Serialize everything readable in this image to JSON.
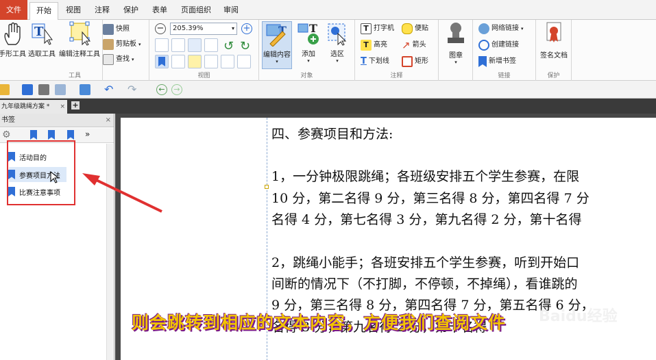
{
  "menu": {
    "tabs": [
      {
        "label": "文件"
      },
      {
        "label": "开始"
      },
      {
        "label": "视图"
      },
      {
        "label": "注释"
      },
      {
        "label": "保护"
      },
      {
        "label": "表单"
      },
      {
        "label": "页面组织"
      },
      {
        "label": "审阅"
      }
    ]
  },
  "ribbon": {
    "tools": {
      "group_label": "工具",
      "hand": "手形工具",
      "select": "选取工具",
      "edit_annot": "编辑注释工具",
      "snapshot": "快照",
      "clipboard": "剪贴板",
      "find": "查找"
    },
    "view": {
      "group_label": "视图",
      "zoom_value": "205.39%"
    },
    "objects": {
      "group_label": "对象",
      "edit_content": "编辑内容",
      "add": "添加",
      "select_area": "选区"
    },
    "comment": {
      "group_label": "注释",
      "typewriter": "打字机",
      "note": "便贴",
      "highlight": "高亮",
      "arrow": "箭头",
      "underline": "下划线",
      "rectangle": "矩形"
    },
    "stamp": {
      "label": "图章"
    },
    "links": {
      "group_label": "链接",
      "web_link": "网络链接",
      "create_link": "创建链接",
      "new_bookmark": "新增书签"
    },
    "protect": {
      "group_label": "保护",
      "sign": "签名文档"
    }
  },
  "document_tab": {
    "title": "九年级跳绳方案 *",
    "close": "×",
    "new_tab": "+"
  },
  "bookmarks_panel": {
    "title": "书签",
    "close": "×",
    "items": [
      {
        "label": "活动目的"
      },
      {
        "label": "参赛项目方法"
      },
      {
        "label": "比赛注意事项"
      }
    ]
  },
  "document": {
    "lines": [
      "四、参赛项目和方法:",
      "1，一分钟极限跳绳；各班级安排五个学生参赛，在限",
      "10 分，第二名得 9 分，第三名得 8 分，第四名得 7 分",
      "名得 4 分，第七名得 3 分，第九名得 2 分，第十名得",
      "2，跳绳小能手；各班安排五个学生参赛，听到开始口",
      "间断的情况下（不打脚，不停顿，不掉绳），看谁跳的",
      "9 分，第三名得 8 分，第四名得 7 分，第五名得 6 分，",
      "名得 3 分，第九名得 2 分，第十名得"
    ]
  },
  "overlay": {
    "subtitle": "则会跳转到相应的文本内容，方便我们查阅文件",
    "watermark_baidu": "Baidu经验",
    "watermark_url": "jingyan.baidu.com"
  },
  "colors": {
    "accent_file_tab": "#d4452b",
    "bookmark_icon": "#2f6fd6",
    "highlight_box": "#e03030",
    "subtitle": "#f2c400"
  }
}
